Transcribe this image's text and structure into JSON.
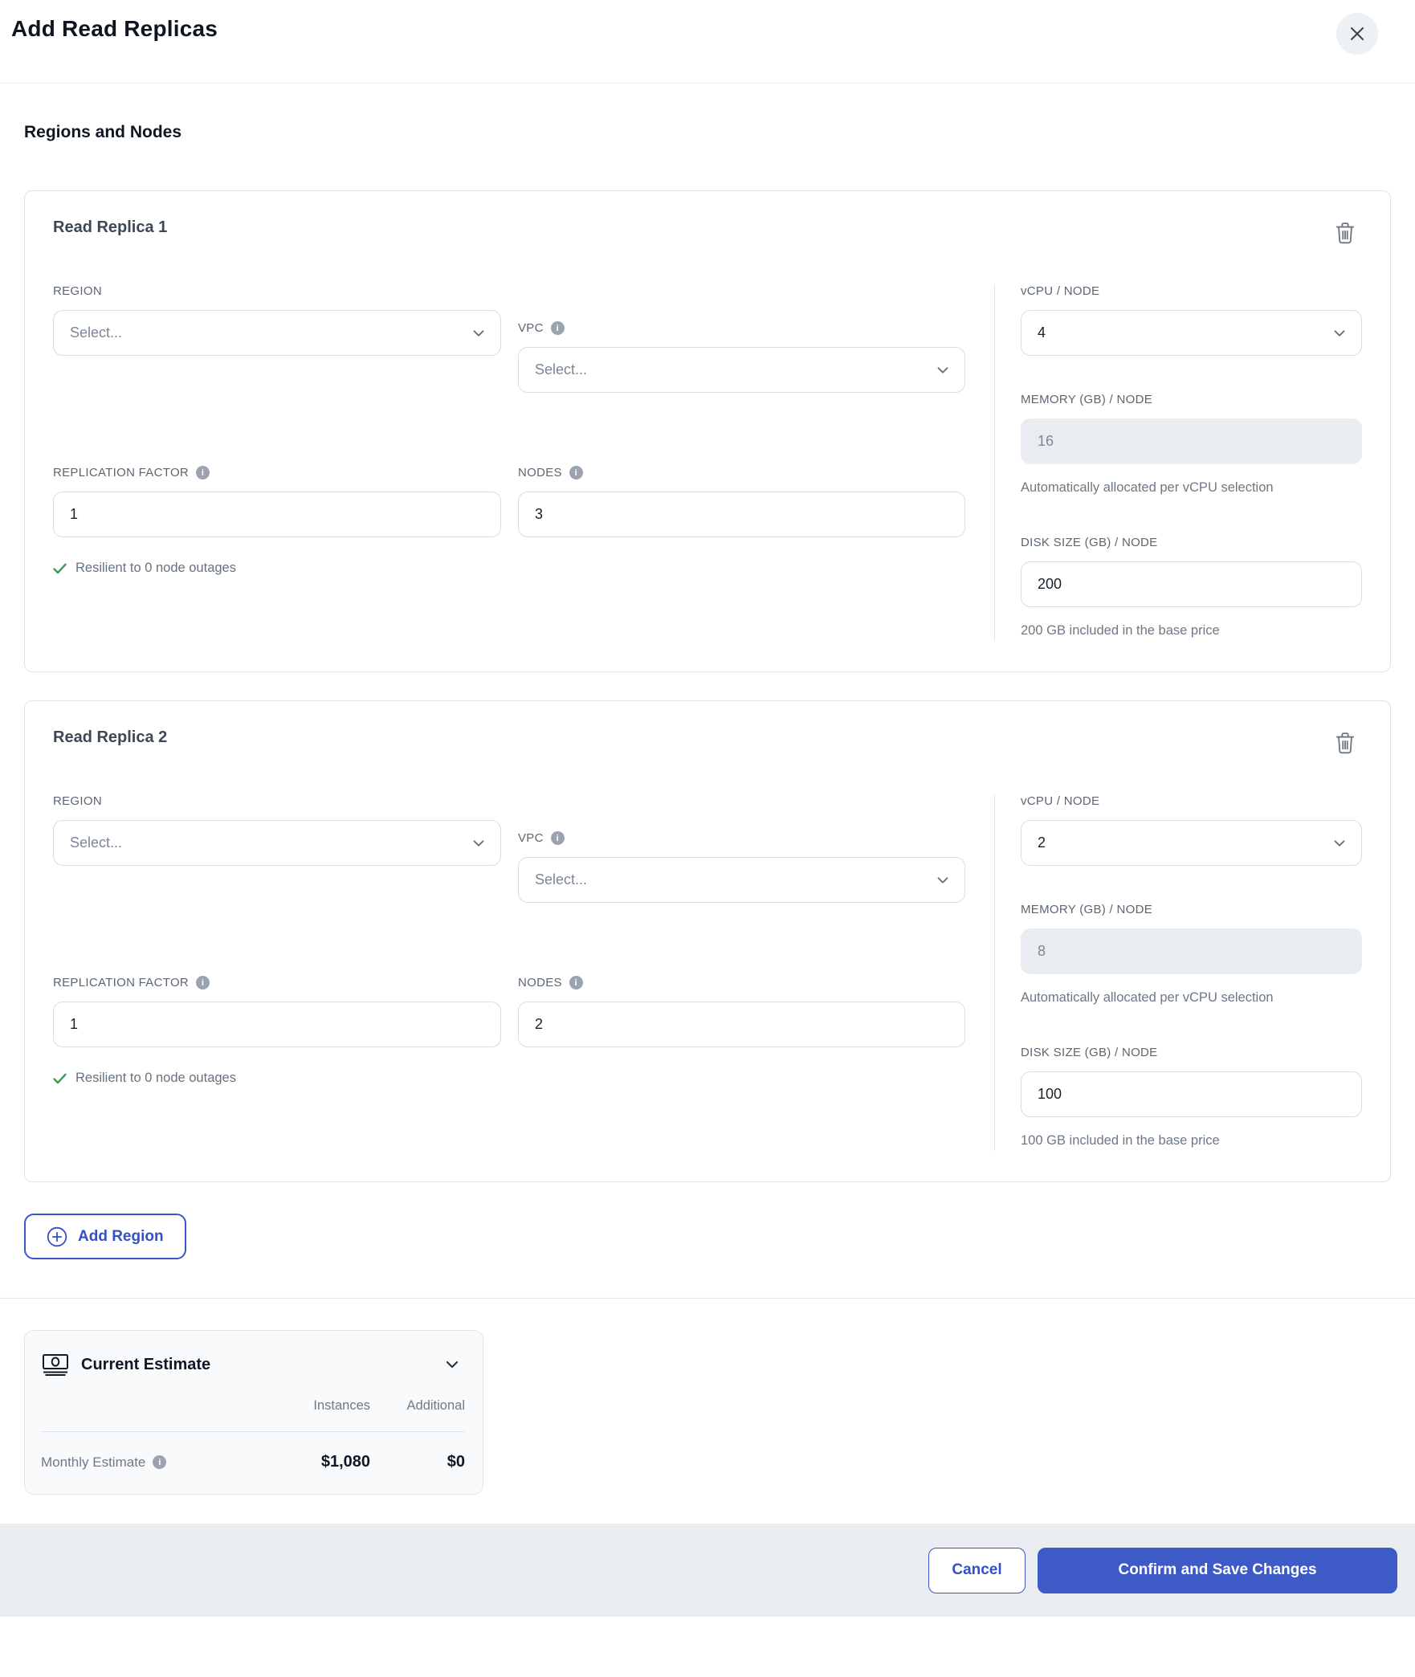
{
  "modal": {
    "title": "Add Read Replicas"
  },
  "section_title": "Regions and Nodes",
  "select_placeholder": "Select...",
  "replicas": [
    {
      "title": "Read Replica 1",
      "region_label": "REGION",
      "region_value": "Select...",
      "vpc_label": "VPC",
      "vpc_value": "Select...",
      "replication_label": "REPLICATION FACTOR",
      "replication_value": "1",
      "nodes_label": "NODES",
      "nodes_value": "3",
      "resilience_note": "Resilient to 0 node outages",
      "vcpu_label": "vCPU / NODE",
      "vcpu_value": "4",
      "memory_label": "MEMORY (GB) / NODE",
      "memory_value": "16",
      "memory_note": "Automatically allocated per vCPU selection",
      "disk_label": "DISK SIZE (GB) / NODE",
      "disk_value": "200",
      "disk_note": "200 GB included in the base price"
    },
    {
      "title": "Read Replica 2",
      "region_label": "REGION",
      "region_value": "Select...",
      "vpc_label": "VPC",
      "vpc_value": "Select...",
      "replication_label": "REPLICATION FACTOR",
      "replication_value": "1",
      "nodes_label": "NODES",
      "nodes_value": "2",
      "resilience_note": "Resilient to 0 node outages",
      "vcpu_label": "vCPU / NODE",
      "vcpu_value": "2",
      "memory_label": "MEMORY (GB) / NODE",
      "memory_value": "8",
      "memory_note": "Automatically allocated per vCPU selection",
      "disk_label": "DISK SIZE (GB) / NODE",
      "disk_value": "100",
      "disk_note": "100 GB included in the base price"
    }
  ],
  "add_region_label": "Add Region",
  "estimate": {
    "title": "Current Estimate",
    "col_instances": "Instances",
    "col_additional": "Additional",
    "row_label": "Monthly Estimate",
    "instances_value": "$1,080",
    "additional_value": "$0"
  },
  "footer": {
    "cancel_label": "Cancel",
    "confirm_label": "Confirm and Save Changes"
  },
  "colors": {
    "accent_blue": "#3d5ac6",
    "success_green": "#3d9a50"
  }
}
